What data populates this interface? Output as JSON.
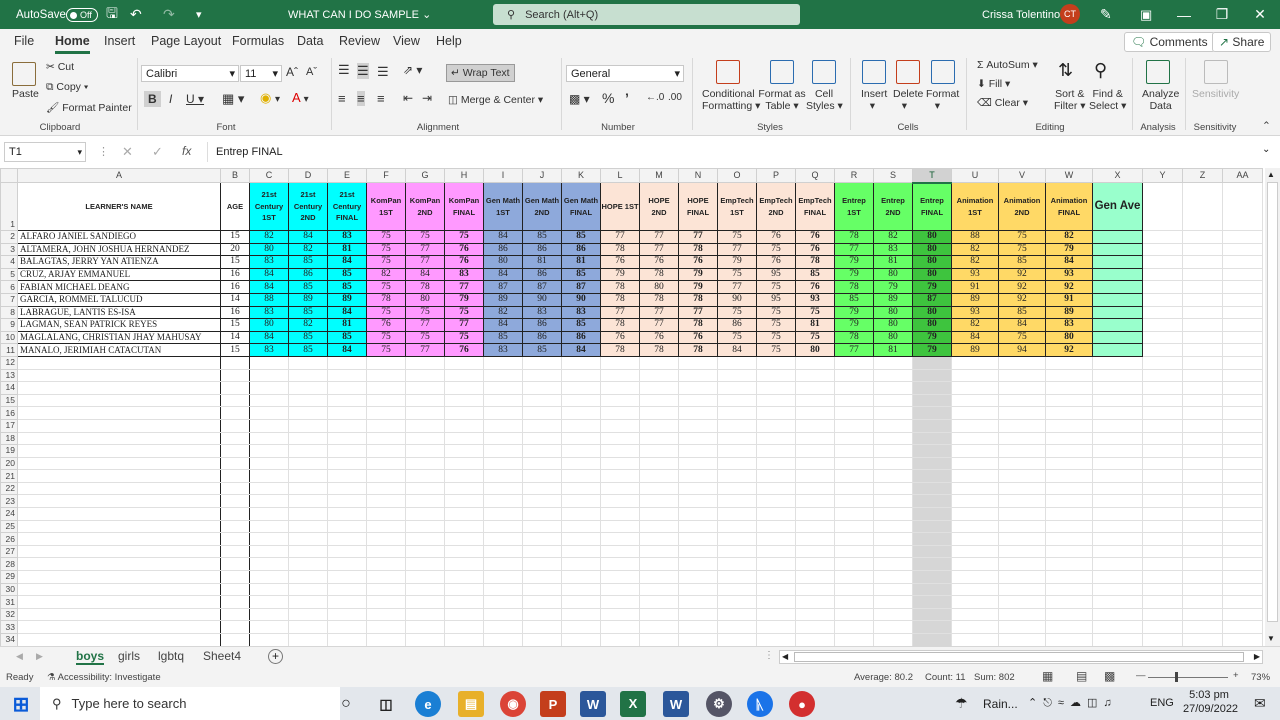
{
  "titlebar": {
    "autosave": "AutoSave",
    "autosave_state": "Off",
    "doc_title": "WHAT CAN I DO SAMPLE",
    "search_placeholder": "Search (Alt+Q)",
    "user": "Crissa Tolentino",
    "initials": "CT"
  },
  "tabs": [
    "File",
    "Home",
    "Insert",
    "Page Layout",
    "Formulas",
    "Data",
    "Review",
    "View",
    "Help"
  ],
  "comments": "Comments",
  "share": "Share",
  "ribbon": {
    "cut": "Cut",
    "copy": "Copy",
    "paste": "Paste",
    "format_painter": "Format Painter",
    "clipboard": "Clipboard",
    "font_name": "Calibri",
    "font_size": "11",
    "font": "Font",
    "wrap": "Wrap Text",
    "merge": "Merge & Center",
    "alignment": "Alignment",
    "number_format": "General",
    "number": "Number",
    "cond1": "Conditional",
    "cond2": "Formatting",
    "fmt1": "Format as",
    "fmt2": "Table",
    "cell1": "Cell",
    "cell2": "Styles",
    "styles": "Styles",
    "insert": "Insert",
    "delete": "Delete",
    "format": "Format",
    "cells": "Cells",
    "autosum": "AutoSum",
    "fill": "Fill",
    "clear": "Clear",
    "sort1": "Sort &",
    "sort2": "Filter",
    "find1": "Find &",
    "find2": "Select",
    "editing": "Editing",
    "analyze1": "Analyze",
    "analyze2": "Data",
    "analysis": "Analysis",
    "sensitivity": "Sensitivity"
  },
  "formula": {
    "namebox": "T1",
    "fx": "fx",
    "content": "Entrep  FINAL"
  },
  "columns": [
    "A",
    "B",
    "C",
    "D",
    "E",
    "F",
    "G",
    "H",
    "I",
    "J",
    "K",
    "L",
    "M",
    "N",
    "O",
    "P",
    "Q",
    "R",
    "S",
    "T",
    "U",
    "V",
    "W",
    "X",
    "Y",
    "Z",
    "AA"
  ],
  "headers": [
    "LEARNER'S NAME",
    "AGE",
    "21st Century 1ST",
    "21st Century 2ND",
    "21st Century FINAL",
    "KomPan 1ST",
    "KomPan 2ND",
    "KomPan FINAL",
    "Gen Math 1ST",
    "Gen Math 2ND",
    "Gen Math FINAL",
    "HOPE 1ST",
    "HOPE 2ND",
    "HOPE FINAL",
    "EmpTech 1ST",
    "EmpTech 2ND",
    "EmpTech FINAL",
    "Entrep 1ST",
    "Entrep 2ND",
    "Entrep FINAL",
    "Animation 1ST",
    "Animation 2ND",
    "Animation FINAL",
    "Gen Ave"
  ],
  "rows": [
    [
      "ALFARO JANIEL SANDIEGO",
      "15",
      "82",
      "84",
      "83",
      "75",
      "75",
      "75",
      "84",
      "85",
      "85",
      "77",
      "77",
      "77",
      "75",
      "76",
      "76",
      "78",
      "82",
      "80",
      "88",
      "75",
      "82"
    ],
    [
      "ALTAMERA, JOHN JOSHUA HERNANDEZ",
      "20",
      "80",
      "82",
      "81",
      "75",
      "77",
      "76",
      "86",
      "86",
      "86",
      "78",
      "77",
      "78",
      "77",
      "75",
      "76",
      "77",
      "83",
      "80",
      "82",
      "75",
      "79"
    ],
    [
      "BALAGTAS, JERRY YAN ATIENZA",
      "15",
      "83",
      "85",
      "84",
      "75",
      "77",
      "76",
      "80",
      "81",
      "81",
      "76",
      "76",
      "76",
      "79",
      "76",
      "78",
      "79",
      "81",
      "80",
      "82",
      "85",
      "84"
    ],
    [
      "CRUZ, ARJAY EMMANUEL",
      "16",
      "84",
      "86",
      "85",
      "82",
      "84",
      "83",
      "84",
      "86",
      "85",
      "79",
      "78",
      "79",
      "75",
      "95",
      "85",
      "79",
      "80",
      "80",
      "93",
      "92",
      "93"
    ],
    [
      "FABIAN MICHAEL DEANG",
      "16",
      "84",
      "85",
      "85",
      "75",
      "78",
      "77",
      "87",
      "87",
      "87",
      "78",
      "80",
      "79",
      "77",
      "75",
      "76",
      "78",
      "79",
      "79",
      "91",
      "92",
      "92"
    ],
    [
      "GARCIA, ROMMEL TALUCUD",
      "14",
      "88",
      "89",
      "89",
      "78",
      "80",
      "79",
      "89",
      "90",
      "90",
      "78",
      "78",
      "78",
      "90",
      "95",
      "93",
      "85",
      "89",
      "87",
      "89",
      "92",
      "91"
    ],
    [
      "LABRAGUE, LANTIS ES-ISA",
      "16",
      "83",
      "85",
      "84",
      "75",
      "75",
      "75",
      "82",
      "83",
      "83",
      "77",
      "77",
      "77",
      "75",
      "75",
      "75",
      "79",
      "80",
      "80",
      "93",
      "85",
      "89"
    ],
    [
      "LAGMAN, SEAN PATRICK REYES",
      "15",
      "80",
      "82",
      "81",
      "76",
      "77",
      "77",
      "84",
      "86",
      "85",
      "78",
      "77",
      "78",
      "86",
      "75",
      "81",
      "79",
      "80",
      "80",
      "82",
      "84",
      "83"
    ],
    [
      "MAGLALANG, CHRISTIAN JHAY MAHUSAY",
      "14",
      "84",
      "85",
      "85",
      "75",
      "75",
      "75",
      "85",
      "86",
      "86",
      "76",
      "76",
      "76",
      "75",
      "75",
      "75",
      "78",
      "80",
      "79",
      "84",
      "75",
      "80"
    ],
    [
      "MANALO, JERIMIAH CATACUTAN",
      "15",
      "83",
      "85",
      "84",
      "75",
      "77",
      "76",
      "83",
      "85",
      "84",
      "78",
      "78",
      "78",
      "84",
      "75",
      "80",
      "77",
      "81",
      "79",
      "89",
      "94",
      "92"
    ]
  ],
  "group_colors": [
    "#00ffff",
    "#ff99ff",
    "#8ea9db",
    "#fce4d6",
    "#fce4d6",
    "#66ff66",
    "#ffd966",
    "#99ffcc"
  ],
  "sheets": [
    "boys",
    "girls",
    "lgbtq",
    "Sheet4"
  ],
  "status": {
    "ready": "Ready",
    "accessibility": "Accessibility: Investigate",
    "average": "Average: 80.2",
    "count": "Count: 11",
    "sum": "Sum: 802",
    "zoom": "73%"
  },
  "taskbar": {
    "search": "Type here to search",
    "weather": "Rain...",
    "lang": "ENG",
    "time": "5:03 pm",
    "date": "27/09/2022"
  }
}
